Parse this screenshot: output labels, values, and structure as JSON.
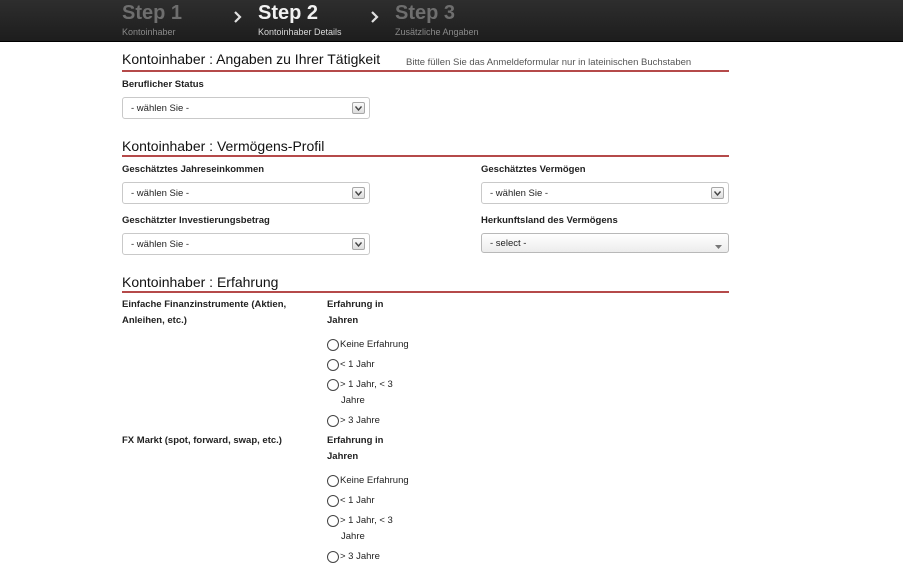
{
  "steps": [
    {
      "title": "Step 1",
      "subtitle": "Kontoinhaber",
      "state": "inactive"
    },
    {
      "title": "Step 2",
      "subtitle": "Kontoinhaber Details",
      "state": "active"
    },
    {
      "title": "Step 3",
      "subtitle": "Zusätzliche Angaben",
      "state": "inactive"
    }
  ],
  "step_separator_icon": "chevron-right-icon",
  "section_activity": {
    "title": "Kontoinhaber : Angaben zu Ihrer Tätigkeit",
    "hint": "Bitte füllen Sie das Anmeldeformular nur in lateinischen Buchstaben",
    "fields": {
      "professional_status": {
        "label": "Beruflicher Status",
        "value": "- wählen Sie -"
      }
    }
  },
  "section_assets": {
    "title": "Kontoinhaber : Vermögens-Profil",
    "fields": {
      "annual_income": {
        "label": "Geschätztes Jahreseinkommen",
        "value": "- wählen Sie -"
      },
      "estimated_assets": {
        "label": "Geschätztes Vermögen",
        "value": "- wählen Sie -"
      },
      "investment_amount": {
        "label": "Geschätzter Investierungsbetrag",
        "value": "- wählen Sie -"
      },
      "asset_origin_country": {
        "label": "Herkunftsland des Vermögens",
        "value": "- select -"
      }
    }
  },
  "section_experience": {
    "title": "Kontoinhaber : Erfahrung",
    "groups": [
      {
        "label_line1": "Einfache Finanzinstrumente (Aktien,",
        "label_line2": "Anleihen, etc.)",
        "years_label_line1": "Erfahrung in",
        "years_label_line2": "Jahren",
        "options": [
          "Keine Erfahrung",
          "< 1 Jahr",
          "> 1 Jahr, < 3",
          "Jahre",
          "> 3 Jahre"
        ]
      },
      {
        "label_line1": "FX Markt (spot, forward, swap, etc.)",
        "years_label_line1": "Erfahrung in",
        "years_label_line2": "Jahren",
        "options": [
          "Keine Erfahrung",
          "< 1 Jahr",
          "> 1 Jahr, < 3",
          "Jahre",
          "> 3 Jahre"
        ]
      }
    ]
  },
  "colors": {
    "header_bg": "#222222",
    "section_rule": "#b54a4a"
  }
}
